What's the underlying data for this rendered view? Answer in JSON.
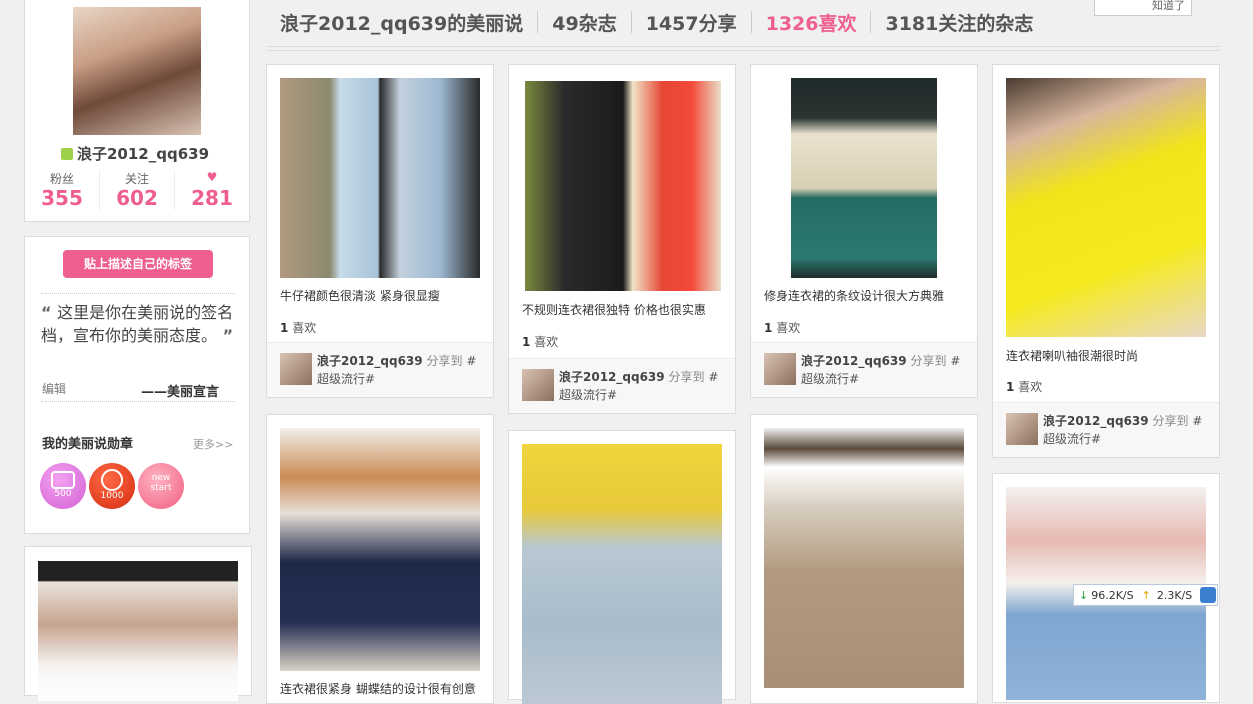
{
  "header": {
    "title": "浪子2012_qq639的美丽说",
    "magazines": "49杂志",
    "shares": "1457分享",
    "likes": "1326喜欢",
    "following": "3181关注的杂志",
    "top_box_text": "知道了"
  },
  "profile": {
    "username": "浪子2012_qq639",
    "stats": [
      {
        "label": "粉丝",
        "value": "355"
      },
      {
        "label": "关注",
        "value": "602"
      },
      {
        "label": "♥",
        "value": "281"
      }
    ]
  },
  "sign_box": {
    "tag_button": "贴上描述自己的标签",
    "signature": "这里是你在美丽说的签名档，宣布你的美丽态度。",
    "edit_label": "编辑",
    "declaration": "——美丽宣言",
    "medals_title": "我的美丽说勋章",
    "more_label": "更多>>",
    "medals": [
      {
        "name": "comment-medal-icon",
        "label": "500"
      },
      {
        "name": "share-medal-icon",
        "label": "1000"
      },
      {
        "name": "new-start-medal-icon",
        "label": "new start"
      }
    ]
  },
  "posts": [
    {
      "desc": "牛仔裙颜色很清淡  紧身很显瘦",
      "likes_num": "1",
      "likes_label": "喜欢",
      "user": "浪子2012_qq639",
      "shared": "分享到",
      "board": "#超级流行#"
    },
    {
      "desc": "不规则连衣裙很独特  价格也很实惠",
      "likes_num": "1",
      "likes_label": "喜欢",
      "user": "浪子2012_qq639",
      "shared": "分享到",
      "board": "#超级流行#"
    },
    {
      "desc": "修身连衣裙的条纹设计很大方典雅",
      "likes_num": "1",
      "likes_label": "喜欢",
      "user": "浪子2012_qq639",
      "shared": "分享到",
      "board": "#超级流行#"
    },
    {
      "desc": "连衣裙喇叭袖很潮很时尚",
      "likes_num": "1",
      "likes_label": "喜欢",
      "user": "浪子2012_qq639",
      "shared": "分享到",
      "board": "#超级流行#"
    },
    {
      "desc": "连衣裙很紧身  蝴蝶结的设计很有创意"
    }
  ],
  "speed": {
    "down": "96.2K/S",
    "up": "2.3K/S"
  },
  "colors": {
    "accent": "#ee5e8f",
    "yellow": "#f2e41a"
  }
}
